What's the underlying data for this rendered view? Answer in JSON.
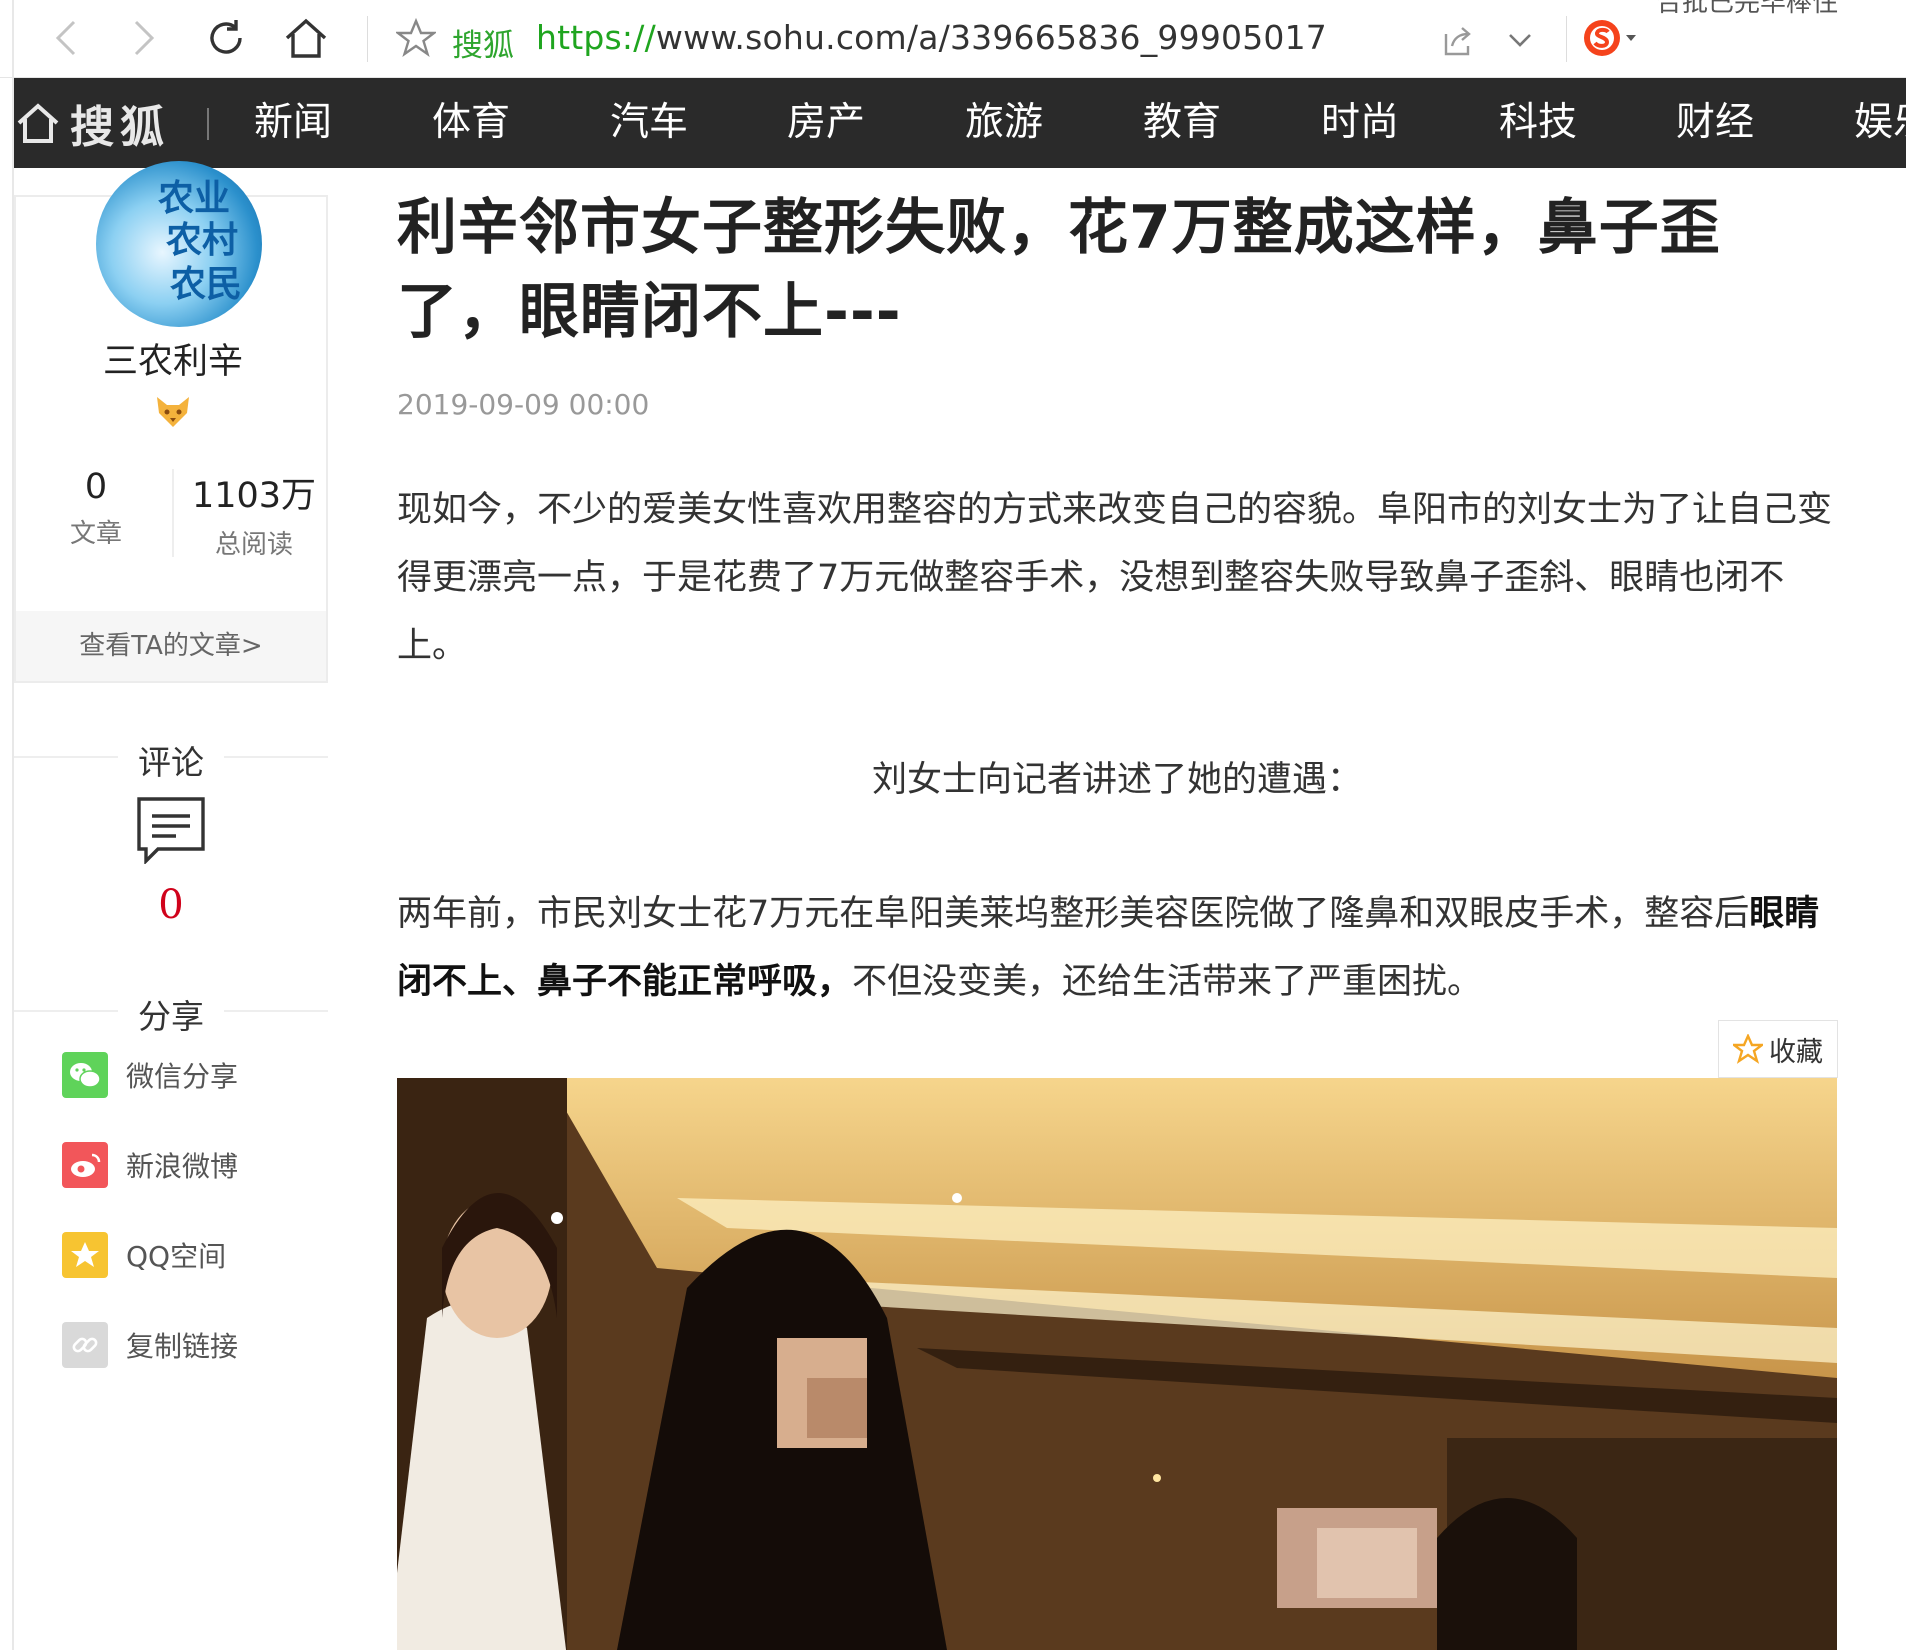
{
  "browser": {
    "site_name": "搜狐",
    "url_scheme": "https://",
    "url_rest": "www.sohu.com/a/339665836_99905017",
    "corner_text": "合批已完毕棒住"
  },
  "navbar": {
    "brand": "搜狐",
    "items": [
      "新闻",
      "体育",
      "汽车",
      "房产",
      "旅游",
      "教育",
      "时尚",
      "科技",
      "财经",
      "娱乐"
    ]
  },
  "author": {
    "avatar_lines": [
      "农业",
      "农村",
      "农民"
    ],
    "name": "三农利辛",
    "articles_count": "0",
    "articles_label": "文章",
    "reads_count": "1103万",
    "reads_label": "总阅读",
    "view_articles": "查看TA的文章>"
  },
  "comments": {
    "title": "评论",
    "count": "0"
  },
  "share": {
    "title": "分享",
    "items": [
      {
        "label": "微信分享",
        "icon": "wechat-icon",
        "color": "#5fd35a"
      },
      {
        "label": "新浪微博",
        "icon": "weibo-icon",
        "color": "#f2565a"
      },
      {
        "label": "QQ空间",
        "icon": "qzone-icon",
        "color": "#f7c431"
      },
      {
        "label": "复制链接",
        "icon": "link-icon",
        "color": "#d9d9d9"
      }
    ]
  },
  "article": {
    "title": "利辛邻市女子整形失败，花7万整成这样，鼻子歪了，眼睛闭不上---",
    "date": "2019-09-09 00:00",
    "p1": "现如今，不少的爱美女性喜欢用整容的方式来改变自己的容貌。阜阳市的刘女士为了让自己变得更漂亮一点，于是花费了7万元做整容手术，没想到整容失败导致鼻子歪斜、眼睛也闭不上。",
    "p2": "刘女士向记者讲述了她的遭遇：",
    "p3_a": "两年前，市民刘女士花7万元在阜阳美莱坞整形美容医院做了隆鼻和双眼皮手术，整容后",
    "p3_bold": "眼睛闭不上、鼻子不能正常呼吸，",
    "p3_c": "不但没变美，还给生活带来了严重困扰。",
    "collect_label": "收藏"
  },
  "colors": {
    "navbar_bg": "#2a2a2a",
    "site_green": "#2ea52e",
    "comment_count_red": "#d0021b"
  }
}
